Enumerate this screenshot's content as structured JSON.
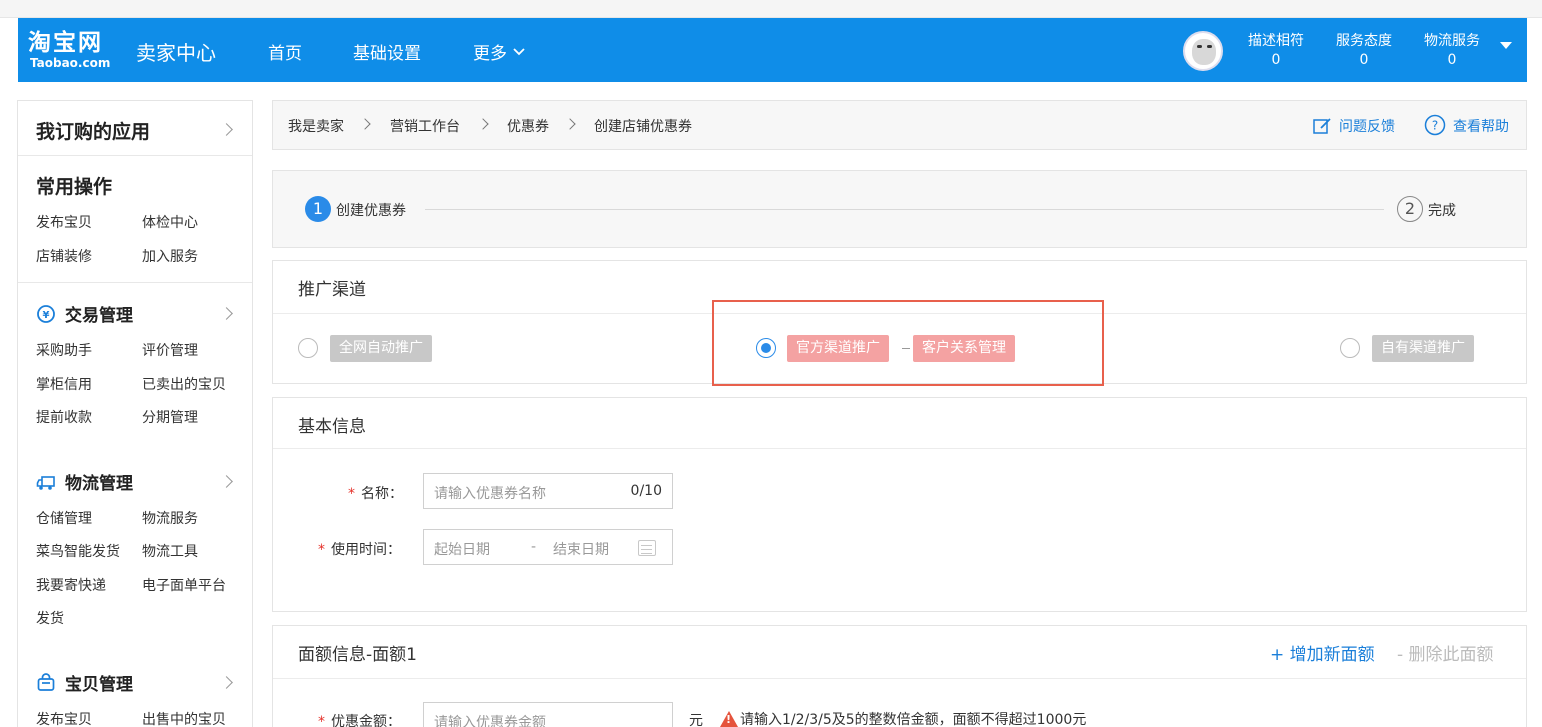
{
  "header": {
    "logo_main": "淘宝网",
    "logo_sub": "Taobao.com",
    "seller_center": "卖家中心",
    "nav": [
      "首页",
      "基础设置",
      "更多"
    ],
    "scores": [
      {
        "label": "描述相符",
        "value": "0"
      },
      {
        "label": "服务态度",
        "value": "0"
      },
      {
        "label": "物流服务",
        "value": "0"
      }
    ]
  },
  "sidebar": {
    "apps_title": "我订购的应用",
    "common_title": "常用操作",
    "common_links": [
      "发布宝贝",
      "体检中心",
      "店铺装修",
      "加入服务"
    ],
    "trade": {
      "title": "交易管理",
      "links": [
        "采购助手",
        "评价管理",
        "掌柜信用",
        "已卖出的宝贝",
        "提前收款",
        "分期管理"
      ]
    },
    "logistics": {
      "title": "物流管理",
      "links": [
        "仓储管理",
        "物流服务",
        "菜鸟智能发货",
        "物流工具",
        "我要寄快递",
        "电子面单平台",
        "发货"
      ]
    },
    "goods": {
      "title": "宝贝管理",
      "links": [
        "发布宝贝",
        "出售中的宝贝"
      ]
    }
  },
  "breadcrumb": {
    "items": [
      "我是卖家",
      "营销工作台",
      "优惠券",
      "创建店铺优惠券"
    ],
    "feedback": "问题反馈",
    "help": "查看帮助"
  },
  "steps": [
    {
      "num": "1",
      "label": "创建优惠券",
      "active": true
    },
    {
      "num": "2",
      "label": "完成",
      "active": false
    }
  ],
  "channel": {
    "title": "推广渠道",
    "options": [
      "全网自动推广",
      "官方渠道推广",
      "客户关系管理",
      "自有渠道推广"
    ],
    "selected": "官方渠道推广"
  },
  "basic": {
    "title": "基本信息",
    "name_label": "名称：",
    "name_placeholder": "请输入优惠券名称",
    "name_counter": "0/10",
    "time_label": "使用时间：",
    "start_placeholder": "起始日期",
    "date_sep": "-",
    "end_placeholder": "结束日期"
  },
  "amount": {
    "title": "面额信息-面额1",
    "add": "+ 增加新面额",
    "remove": "- 删除此面额",
    "label": "优惠金额：",
    "placeholder": "请输入优惠券金额",
    "unit": "元",
    "hint": "请输入1/2/3/5及5的整数倍金额，面额不得超过1000元"
  },
  "colors": {
    "header_bg": "#0f8de8",
    "accent": "#2a8be8",
    "link": "#1b7fd9",
    "tag_pink": "#f4a2a2",
    "highlight": "#e8604c"
  }
}
